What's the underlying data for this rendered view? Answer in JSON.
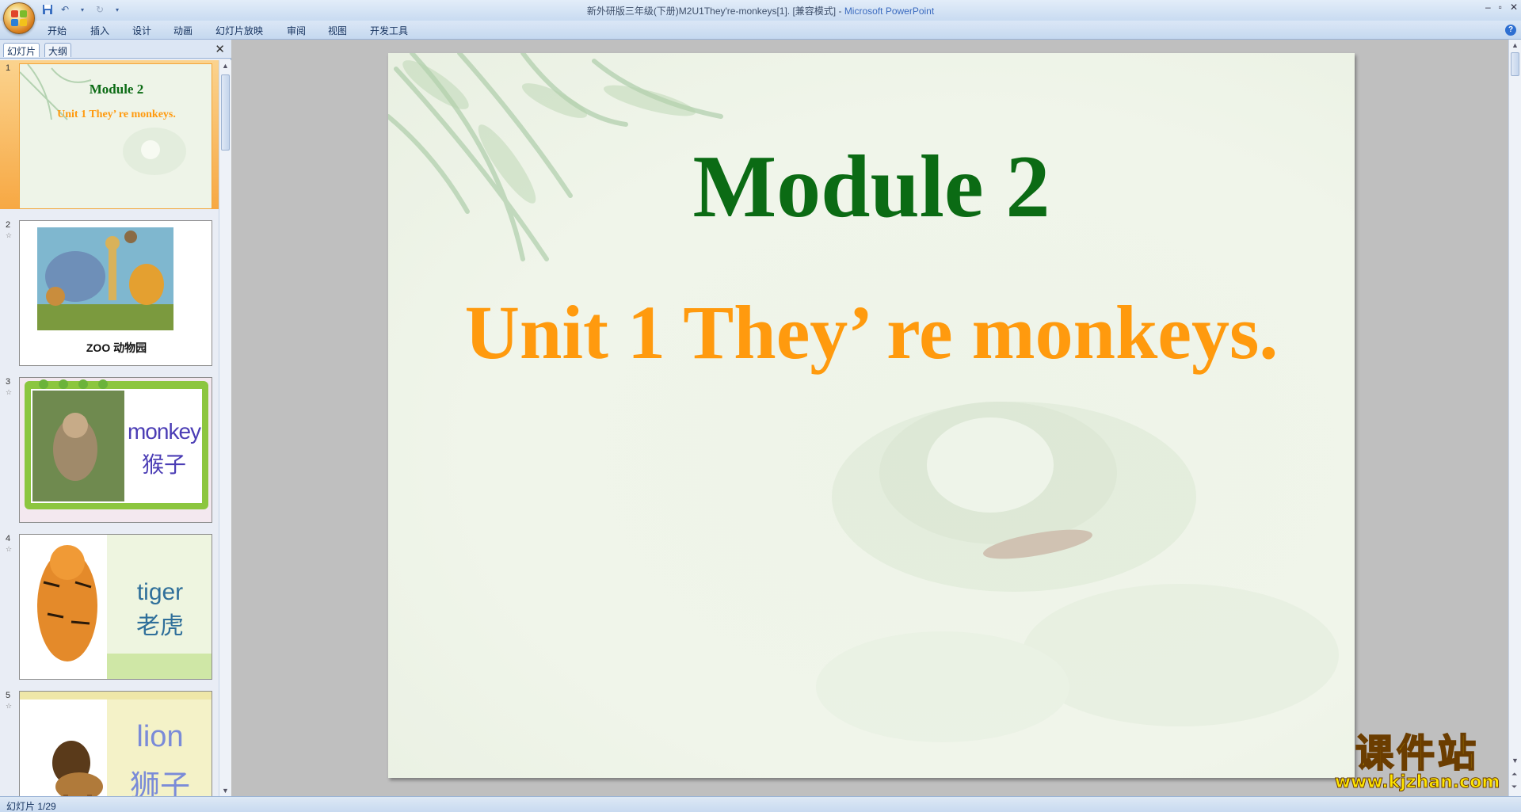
{
  "window": {
    "title_doc": "新外研版三年级(下册)M2U1They're-monkeys[1]. [兼容模式] - ",
    "title_app": "Microsoft PowerPoint"
  },
  "ribbon_tabs": [
    "开始",
    "插入",
    "设计",
    "动画",
    "幻灯片放映",
    "审阅",
    "视图",
    "开发工具"
  ],
  "left_pane": {
    "tabs": [
      "幻灯片",
      "大纲"
    ],
    "close_glyph": "✕"
  },
  "thumbnails": [
    {
      "num": "1",
      "title": "Module 2",
      "subtitle": "Unit 1 They’ re monkeys."
    },
    {
      "num": "2",
      "caption": "ZOO 动物园"
    },
    {
      "num": "3",
      "word": "monkey",
      "cn": "猴子"
    },
    {
      "num": "4",
      "word": "tiger",
      "cn": "老虎"
    },
    {
      "num": "5",
      "word": "lion",
      "cn": "狮子"
    }
  ],
  "slide": {
    "title": "Module 2",
    "subtitle": "Unit 1 They’ re monkeys."
  },
  "watermark": {
    "cn": "课件站",
    "url": "www.kjzhan.com"
  },
  "status": {
    "slide_counter": "幻灯片 1/29"
  },
  "colors": {
    "title_green": "#0b6b14",
    "subtitle_orange": "#ff9a0e",
    "selected_thumb": "#f7a843"
  }
}
